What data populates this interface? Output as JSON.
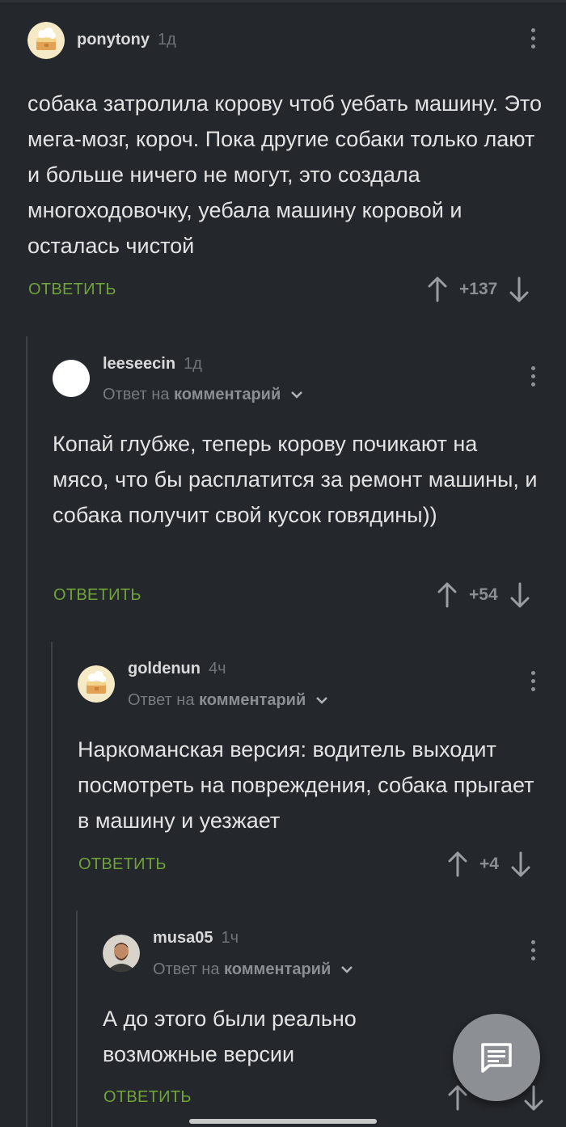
{
  "comments": [
    {
      "username": "ponytony",
      "time": "1д",
      "text": "собака затролила корову чтоб уебать машину. Это мега-мозг, короч. Пока другие собаки только лают и больше ничего не могут, это создала многоходовочку, уебала машину коровой и осталась чистой",
      "reply_label": "ОТВЕТИТЬ",
      "score": "+137",
      "avatar": "cake-avatar"
    },
    {
      "username": "leeseecin",
      "time": "1д",
      "reply_to_prefix": "Ответ на",
      "reply_to_target": "комментарий",
      "text": "Копай глубже, теперь корову почикают на мясо, что бы расплатится за ремонт машины, и собака получит  свой кусок говядины))",
      "reply_label": "ОТВЕТИТЬ",
      "score": "+54",
      "avatar": "white-circle-avatar"
    },
    {
      "username": "goldenun",
      "time": "4ч",
      "reply_to_prefix": "Ответ на",
      "reply_to_target": "комментарий",
      "text": "Наркоманская версия: водитель выходит посмотреть на повреждения, собака прыгает в машину и уезжает",
      "reply_label": "ОТВЕТИТЬ",
      "score": "+4",
      "avatar": "cake-avatar"
    },
    {
      "username": "musa05",
      "time": "1ч",
      "reply_to_prefix": "Ответ на",
      "reply_to_target": "комментарий",
      "text": "А до этого были реально возможные версии",
      "reply_label": "ОТВЕТИТЬ",
      "score": "",
      "avatar": "photo-avatar"
    }
  ],
  "colors": {
    "background": "#24272b",
    "reply_green": "#6fa33a",
    "fab": "#8c8f93"
  },
  "icons": [
    "kebab-menu-icon",
    "upvote-arrow-icon",
    "downvote-arrow-icon",
    "chevron-down-icon",
    "comment-icon"
  ]
}
